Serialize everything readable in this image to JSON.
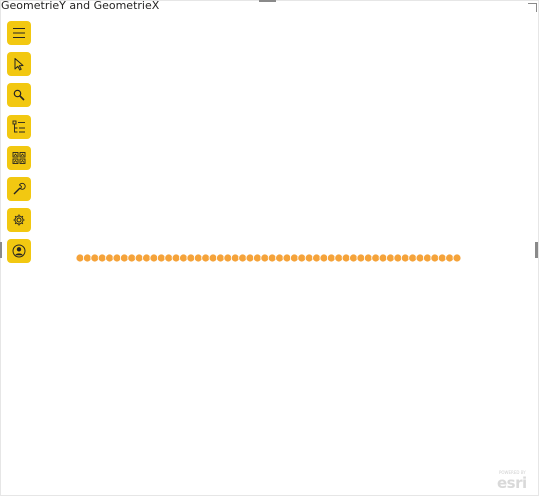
{
  "visual": {
    "title": "GeometrieY and GeometrieX"
  },
  "toolbar": {
    "buttons": [
      {
        "name": "menu-button",
        "icon": "hamburger-icon"
      },
      {
        "name": "select-button",
        "icon": "pointer-icon"
      },
      {
        "name": "search-button",
        "icon": "search-icon"
      },
      {
        "name": "layers-button",
        "icon": "layer-list-icon"
      },
      {
        "name": "basemap-button",
        "icon": "basemap-gallery-icon"
      },
      {
        "name": "tools-button",
        "icon": "wrench-icon"
      },
      {
        "name": "settings-button",
        "icon": "gear-icon"
      },
      {
        "name": "account-button",
        "icon": "user-icon"
      }
    ],
    "accent": "#f2c811",
    "icon_color": "#252423"
  },
  "map": {
    "point_color": "#f5a33a",
    "point_count": 52,
    "attribution": "esri",
    "attribution_sub": "POWERED BY"
  }
}
